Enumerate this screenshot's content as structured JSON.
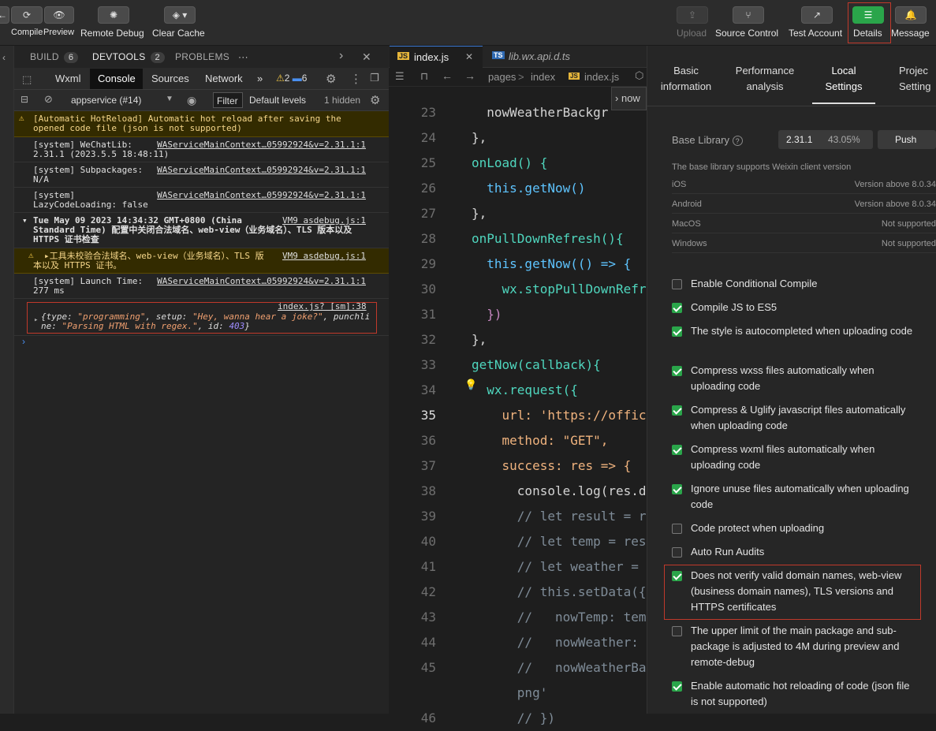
{
  "toolbar": {
    "left_labels": {
      "compile": "Compile",
      "preview": "Preview",
      "remote_debug": "Remote Debug",
      "clear_cache": "Clear Cache"
    },
    "right_labels": {
      "upload": "Upload",
      "source_control": "Source Control",
      "test_account": "Test Account",
      "details": "Details",
      "message": "Message"
    }
  },
  "panel_tabs": {
    "build": "BUILD",
    "build_count": "6",
    "devtools": "DEVTOOLS",
    "devtools_count": "2",
    "problems": "PROBLEMS",
    "more": "···"
  },
  "devtools_tabs": {
    "wxml": "Wxml",
    "console": "Console",
    "sources": "Sources",
    "network": "Network",
    "more": "»",
    "warn_count": "2",
    "msg_count": "6"
  },
  "console_bar": {
    "context": "appservice (#14)",
    "filter": "Filter",
    "levels": "Default levels",
    "hidden": "1 hidden"
  },
  "console": [
    {
      "type": "warn",
      "text": "[Automatic HotReload] Automatic hot reload after saving the\nopened code file (json is not supported)",
      "src": ""
    },
    {
      "type": "log",
      "text": "[system] WeChatLib:\n2.31.1 (2023.5.5 18:48:11)",
      "src": "WAServiceMainContext…05992924&v=2.31.1:1"
    },
    {
      "type": "log",
      "text": "[system] Subpackages:\nN/A",
      "src": "WAServiceMainContext…05992924&v=2.31.1:1"
    },
    {
      "type": "log",
      "text": "[system]\nLazyCodeLoading: false",
      "src": "WAServiceMainContext…05992924&v=2.31.1:1"
    },
    {
      "type": "group",
      "text": "Tue May 09 2023 14:34:32 GMT+0800 (China\nStandard Time) 配置中关闭合法域名、web-view（业务域名）、TLS 版本以及\nHTTPS 证书检查",
      "src": "VM9 asdebug.js:1"
    },
    {
      "type": "warn",
      "text": "▸工具未校验合法域名、web-view（业务域名）、TLS 版\n本以及 HTTPS 证书。",
      "src": "VM9 asdebug.js:1"
    },
    {
      "type": "log",
      "text": "[system] Launch Time:\n277 ms",
      "src": "WAServiceMainContext…05992924&v=2.31.1:1"
    }
  ],
  "console_obj": {
    "src": "index.js? [sm]:38",
    "line1_a": "{type: ",
    "v1": "\"programming\"",
    "line1_b": ", setup: ",
    "v2": "\"Hey, wanna hear a joke?\"",
    "line1_c": ", punchli",
    "line2_a": "ne: ",
    "v3": "\"Parsing HTML with regex.\"",
    "line2_b": ", id: ",
    "v4": "403",
    "line2_c": "}"
  },
  "editor": {
    "tabs": [
      {
        "label": "index.js"
      },
      {
        "label": "lib.wx.api.d.ts"
      }
    ],
    "breadcrumb": {
      "pages": "pages",
      "sep": ">",
      "index": "index",
      "file": "index.js",
      "sym": "now"
    },
    "lines": [
      {
        "n": "23",
        "t": "  nowWeatherBackgr"
      },
      {
        "n": "24",
        "t": "},"
      },
      {
        "n": "25",
        "t": "onLoad() {"
      },
      {
        "n": "26",
        "t": "  this.getNow()"
      },
      {
        "n": "27",
        "t": "},"
      },
      {
        "n": "28",
        "t": "onPullDownRefresh(){"
      },
      {
        "n": "29",
        "t": "  this.getNow(() => {"
      },
      {
        "n": "30",
        "t": "    wx.stopPullDownRefr"
      },
      {
        "n": "31",
        "t": "  })"
      },
      {
        "n": "32",
        "t": "},"
      },
      {
        "n": "33",
        "t": "getNow(callback){"
      },
      {
        "n": "34",
        "t": "  wx.request({"
      },
      {
        "n": "35",
        "t": "    url: 'https://offic"
      },
      {
        "n": "36",
        "t": "    method: \"GET\","
      },
      {
        "n": "37",
        "t": "    success: res => {"
      },
      {
        "n": "38",
        "t": "      console.log(res.d"
      },
      {
        "n": "39",
        "t": "      // let result = r"
      },
      {
        "n": "40",
        "t": "      // let temp = res"
      },
      {
        "n": "41",
        "t": "      // let weather = "
      },
      {
        "n": "42",
        "t": "      // this.setData({"
      },
      {
        "n": "43",
        "t": "      //   nowTemp: tem"
      },
      {
        "n": "44",
        "t": "      //   nowWeather: "
      },
      {
        "n": "45",
        "t": "      //   nowWeatherBa"
      },
      {
        "n": "",
        "t": "      png'"
      },
      {
        "n": "46",
        "t": "      // })"
      }
    ]
  },
  "details": {
    "tabs": {
      "basic": "Basic\ninformation",
      "perf": "Performance\nanalysis",
      "local": "Local\nSettings",
      "project": "Projec\nSetting"
    },
    "base_library": {
      "label": "Base Library",
      "version": "2.31.1",
      "percent": "43.05%",
      "push": "Push"
    },
    "support_title": "The base library supports Weixin client version",
    "support": [
      {
        "os": "iOS",
        "v": "Version above 8.0.34"
      },
      {
        "os": "Android",
        "v": "Version above 8.0.34"
      },
      {
        "os": "MacOS",
        "v": "Not supported"
      },
      {
        "os": "Windows",
        "v": "Not supported"
      }
    ],
    "settings": [
      {
        "label": "Enable Conditional Compile",
        "on": false
      },
      {
        "label": "Compile JS to ES5",
        "on": true
      },
      {
        "label": "The style is autocompleted when uploading code",
        "on": true
      },
      {
        "label": "Compress wxss files automatically when uploading code",
        "on": true
      },
      {
        "label": "Compress & Uglify javascript files automatically when uploading code",
        "on": true
      },
      {
        "label": "Compress wxml files automatically when uploading code",
        "on": true
      },
      {
        "label": "Ignore unuse files automatically when uploading code",
        "on": true
      },
      {
        "label": "Code protect when uploading",
        "on": false
      },
      {
        "label": "Auto Run Audits",
        "on": false
      },
      {
        "label": "Does not verify valid domain names, web-view (business domain names), TLS versions and HTTPS certificates",
        "on": true
      },
      {
        "label": "The upper limit of the main package and sub-package is adjusted to 4M during preview and remote-debug",
        "on": false
      },
      {
        "label": "Enable automatic hot reloading of code (json file is not supported)",
        "on": true
      }
    ]
  }
}
